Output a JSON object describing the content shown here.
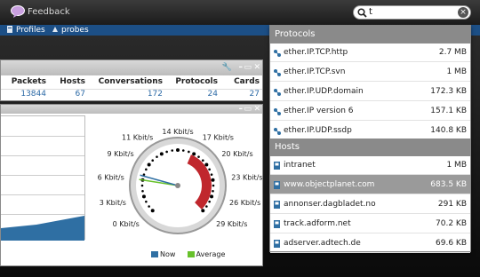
{
  "header": {
    "feedback_label": "Feedback"
  },
  "search": {
    "value": "t"
  },
  "nav": {
    "profiles": "Profiles",
    "probes": "probes"
  },
  "stats": {
    "columns": [
      "Packets",
      "Hosts",
      "Conversations",
      "Protocols",
      "Cards"
    ],
    "values": [
      "13844",
      "67",
      "172",
      "24",
      "27"
    ]
  },
  "gauge": {
    "ticks": [
      "0 Kbit/s",
      "3 Kbit/s",
      "6 Kbit/s",
      "9 Kbit/s",
      "11 Kbit/s",
      "14 Kbit/s",
      "17 Kbit/s",
      "20 Kbit/s",
      "23 Kbit/s",
      "26 Kbit/s",
      "29 Kbit/s"
    ],
    "now_kbit": 6.5,
    "average_kbit": 5.8,
    "max_kbit": 29
  },
  "legend": {
    "now": "Now",
    "average": "Average"
  },
  "colors": {
    "now": "#2f6fa3",
    "average": "#67c12b",
    "selection": "#9a9a9a",
    "gauge_red": "#c0272d"
  },
  "dropdown": {
    "protocols_label": "Protocols",
    "protocols": [
      {
        "name": "ether.IP.TCP.http",
        "size": "2.7 MB"
      },
      {
        "name": "ether.IP.TCP.svn",
        "size": "1 MB"
      },
      {
        "name": "ether.IP.UDP.domain",
        "size": "172.3 KB"
      },
      {
        "name": "ether.IP version 6",
        "size": "157.1 KB"
      },
      {
        "name": "ether.IP.UDP.ssdp",
        "size": "140.8 KB"
      }
    ],
    "hosts_label": "Hosts",
    "hosts": [
      {
        "name": "intranet",
        "size": "1 MB"
      },
      {
        "name": "www.objectplanet.com",
        "size": "683.5 KB",
        "selected": true
      },
      {
        "name": "annonser.dagbladet.no",
        "size": "291 KB"
      },
      {
        "name": "track.adform.net",
        "size": "70.2 KB"
      },
      {
        "name": "adserver.adtech.de",
        "size": "69.6 KB"
      }
    ]
  }
}
